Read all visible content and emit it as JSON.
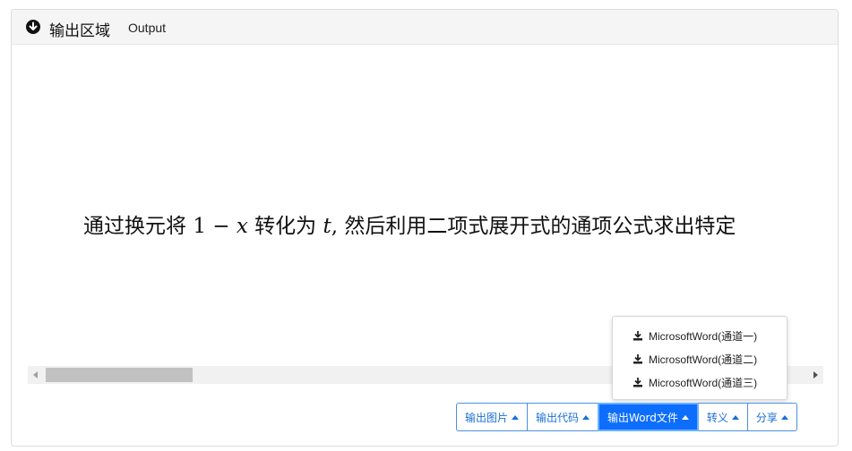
{
  "header": {
    "title": "输出区域",
    "subtitle": "Output"
  },
  "content": {
    "seg1": "通过换元将 ",
    "math1_num": "1",
    "math1_op": " − ",
    "math1_var": "x",
    "seg2": " 转化为 ",
    "math2_var": "t",
    "seg3": ", 然后利用二项式展开式的通项公式求出特定"
  },
  "dropdown": {
    "items": [
      {
        "label": "MicrosoftWord(通道一)"
      },
      {
        "label": "MicrosoftWord(通道二)"
      },
      {
        "label": "MicrosoftWord(通道三)"
      }
    ]
  },
  "buttons": {
    "export_image": "输出图片",
    "export_code": "输出代码",
    "export_word": "输出Word文件",
    "escape": "转义",
    "share": "分享"
  },
  "colors": {
    "accent": "#0d6efd",
    "button_border": "#4a90e2"
  }
}
